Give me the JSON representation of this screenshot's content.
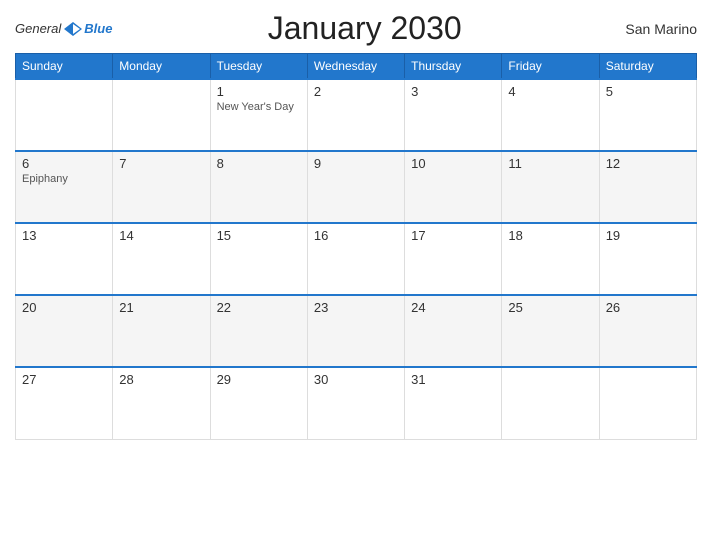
{
  "header": {
    "logo_general": "General",
    "logo_blue": "Blue",
    "title": "January 2030",
    "country": "San Marino"
  },
  "weekdays": [
    "Sunday",
    "Monday",
    "Tuesday",
    "Wednesday",
    "Thursday",
    "Friday",
    "Saturday"
  ],
  "weeks": [
    [
      {
        "day": "",
        "holiday": "",
        "shaded": false
      },
      {
        "day": "",
        "holiday": "",
        "shaded": false
      },
      {
        "day": "1",
        "holiday": "New Year's Day",
        "shaded": false
      },
      {
        "day": "2",
        "holiday": "",
        "shaded": false
      },
      {
        "day": "3",
        "holiday": "",
        "shaded": false
      },
      {
        "day": "4",
        "holiday": "",
        "shaded": false
      },
      {
        "day": "5",
        "holiday": "",
        "shaded": false
      }
    ],
    [
      {
        "day": "6",
        "holiday": "Epiphany",
        "shaded": true
      },
      {
        "day": "7",
        "holiday": "",
        "shaded": true
      },
      {
        "day": "8",
        "holiday": "",
        "shaded": true
      },
      {
        "day": "9",
        "holiday": "",
        "shaded": true
      },
      {
        "day": "10",
        "holiday": "",
        "shaded": true
      },
      {
        "day": "11",
        "holiday": "",
        "shaded": true
      },
      {
        "day": "12",
        "holiday": "",
        "shaded": true
      }
    ],
    [
      {
        "day": "13",
        "holiday": "",
        "shaded": false
      },
      {
        "day": "14",
        "holiday": "",
        "shaded": false
      },
      {
        "day": "15",
        "holiday": "",
        "shaded": false
      },
      {
        "day": "16",
        "holiday": "",
        "shaded": false
      },
      {
        "day": "17",
        "holiday": "",
        "shaded": false
      },
      {
        "day": "18",
        "holiday": "",
        "shaded": false
      },
      {
        "day": "19",
        "holiday": "",
        "shaded": false
      }
    ],
    [
      {
        "day": "20",
        "holiday": "",
        "shaded": true
      },
      {
        "day": "21",
        "holiday": "",
        "shaded": true
      },
      {
        "day": "22",
        "holiday": "",
        "shaded": true
      },
      {
        "day": "23",
        "holiday": "",
        "shaded": true
      },
      {
        "day": "24",
        "holiday": "",
        "shaded": true
      },
      {
        "day": "25",
        "holiday": "",
        "shaded": true
      },
      {
        "day": "26",
        "holiday": "",
        "shaded": true
      }
    ],
    [
      {
        "day": "27",
        "holiday": "",
        "shaded": false
      },
      {
        "day": "28",
        "holiday": "",
        "shaded": false
      },
      {
        "day": "29",
        "holiday": "",
        "shaded": false
      },
      {
        "day": "30",
        "holiday": "",
        "shaded": false
      },
      {
        "day": "31",
        "holiday": "",
        "shaded": false
      },
      {
        "day": "",
        "holiday": "",
        "shaded": false
      },
      {
        "day": "",
        "holiday": "",
        "shaded": false
      }
    ]
  ]
}
